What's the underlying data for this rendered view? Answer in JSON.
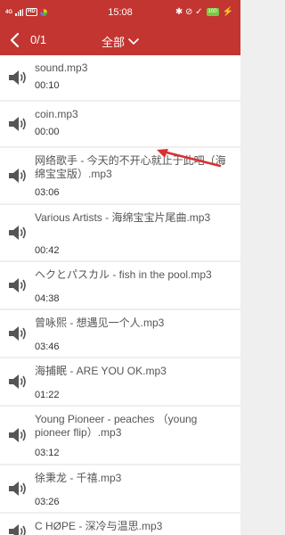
{
  "status": {
    "network": "4G",
    "hd": "HD",
    "time": "15:08",
    "battery": "100",
    "right_icons": "✱ ⊘ ✓"
  },
  "toolbar": {
    "counter": "0/1",
    "filter_label": "全部"
  },
  "items": [
    {
      "title": "sound.mp3",
      "duration": "00:10"
    },
    {
      "title": "coin.mp3",
      "duration": "00:00"
    },
    {
      "title": "网络歌手 - 今天的不开心就止于此吧（海绵宝宝版）.mp3",
      "duration": "03:06"
    },
    {
      "title": "Various Artists - 海绵宝宝片尾曲.mp3",
      "duration": "00:42"
    },
    {
      "title": "ヘクとパスカル - fish in the pool.mp3",
      "duration": "04:38"
    },
    {
      "title": "曾咏熙 - 想遇见一个人.mp3",
      "duration": "03:46"
    },
    {
      "title": "海捕眠 - ARE YOU OK.mp3",
      "duration": "01:22"
    },
    {
      "title": "Young Pioneer - peaches （young pioneer flip）.mp3",
      "duration": "03:12"
    },
    {
      "title": "徐秉龙 - 千禧.mp3",
      "duration": "03:26"
    },
    {
      "title": "C HØPE - 深冷与温思.mp3",
      "duration": ""
    }
  ],
  "colors": {
    "accent": "#c23531",
    "arrow": "#d93030"
  }
}
